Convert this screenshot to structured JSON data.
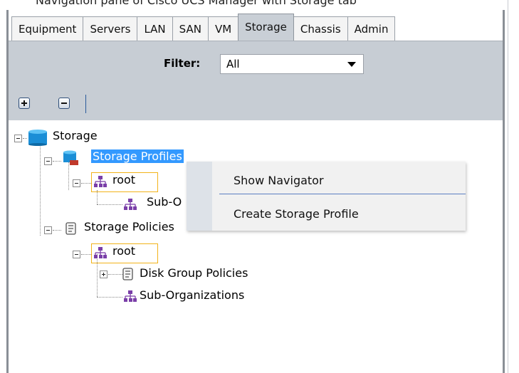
{
  "header_cut": "Navigation pane of Cisco UCS Manager with Storage tab",
  "tabs": [
    {
      "label": "Equipment",
      "active": false
    },
    {
      "label": "Servers",
      "active": false
    },
    {
      "label": "LAN",
      "active": false
    },
    {
      "label": "SAN",
      "active": false
    },
    {
      "label": "VM",
      "active": false
    },
    {
      "label": "Storage",
      "active": true
    },
    {
      "label": "Chassis",
      "active": false
    },
    {
      "label": "Admin",
      "active": false
    }
  ],
  "filter": {
    "label": "Filter:",
    "value": "All"
  },
  "toolbar": {
    "expand_icon": "plus-box-icon",
    "collapse_icon": "minus-box-icon"
  },
  "tree": {
    "root": "Storage",
    "storage_profiles": "Storage Profiles",
    "profiles_root": "root",
    "profiles_suborg": "Sub-O",
    "storage_policies": "Storage Policies",
    "policies_root": "root",
    "disk_group_policies": "Disk Group Policies",
    "sub_organizations": "Sub-Organizations"
  },
  "context_menu": {
    "items": [
      "Show Navigator",
      "Create Storage Profile"
    ]
  },
  "colors": {
    "selection": "#3399ff",
    "panel": "#c7cdd4",
    "highlight_outline": "#f2b31a",
    "menu_separator": "#5b7fc2"
  }
}
